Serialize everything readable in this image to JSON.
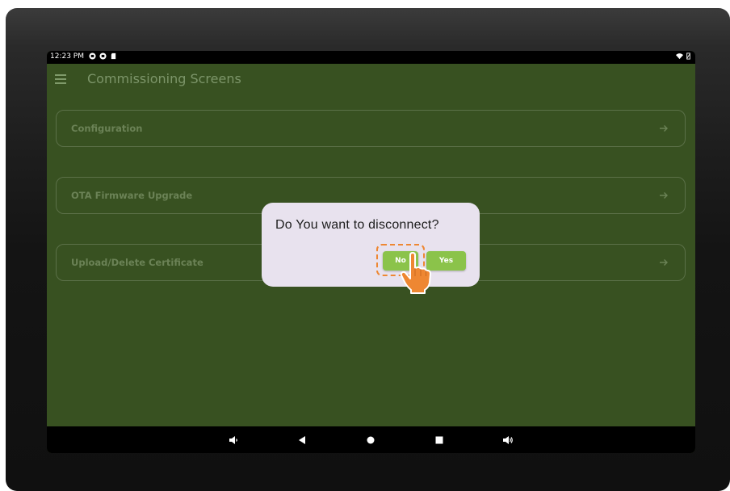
{
  "status_bar": {
    "time": "12:23 PM",
    "icons": [
      "gmail-icon",
      "gmail-icon",
      "sd-card-icon"
    ],
    "right_icons": [
      "wifi-icon",
      "no-battery-icon"
    ]
  },
  "app_bar": {
    "title": "Commissioning Screens"
  },
  "menu": {
    "items": [
      {
        "label": "Configuration"
      },
      {
        "label": "OTA Firmware Upgrade"
      },
      {
        "label": "Upload/Delete Certificate"
      }
    ]
  },
  "dialog": {
    "message": "Do You want to disconnect?",
    "no_label": "No",
    "yes_label": "Yes"
  },
  "nav_bar": {
    "icons": [
      "volume-down-icon",
      "back-icon",
      "home-icon",
      "recents-icon",
      "volume-up-icon"
    ]
  },
  "colors": {
    "background": "#385121",
    "dialog": "#e8e2ee",
    "button": "#8bc34a",
    "highlight": "#ee8732"
  }
}
